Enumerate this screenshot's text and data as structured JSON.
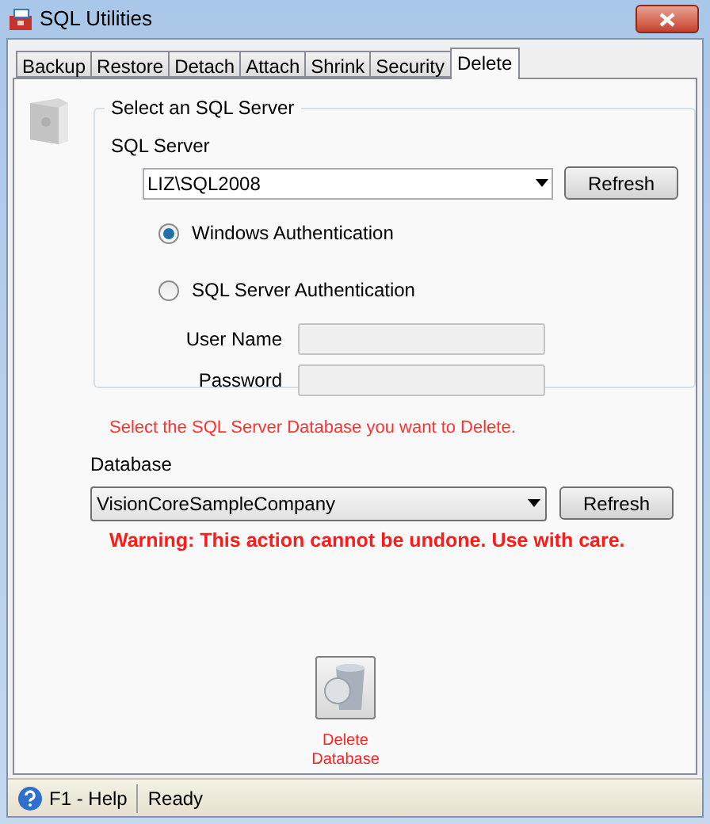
{
  "window": {
    "title": "SQL Utilities"
  },
  "tabs": [
    {
      "label": "Backup",
      "selected": false
    },
    {
      "label": "Restore",
      "selected": false
    },
    {
      "label": "Detach",
      "selected": false
    },
    {
      "label": "Attach",
      "selected": false
    },
    {
      "label": "Shrink",
      "selected": false
    },
    {
      "label": "Security",
      "selected": false
    },
    {
      "label": "Delete",
      "selected": true
    }
  ],
  "server_group": {
    "legend": "Select an SQL Server",
    "server_label": "SQL Server",
    "server_value": "LIZ\\SQL2008",
    "refresh": "Refresh",
    "auth_options": [
      {
        "label": "Windows Authentication",
        "selected": true
      },
      {
        "label": "SQL Server Authentication",
        "selected": false
      }
    ],
    "fields": [
      {
        "label": "User Name",
        "disabled": true
      },
      {
        "label": "Password",
        "disabled": true
      }
    ]
  },
  "database": {
    "instruction": "Select the SQL Server Database you want to Delete.",
    "label": "Database",
    "value": "VisionCoreSampleCompany",
    "refresh": "Refresh",
    "warning": "Warning: This action cannot be undone. Use with care."
  },
  "delete_button": {
    "label_lines": [
      "Delete",
      "Database"
    ]
  },
  "status_bar": {
    "help": "F1 - Help",
    "status": "Ready"
  }
}
